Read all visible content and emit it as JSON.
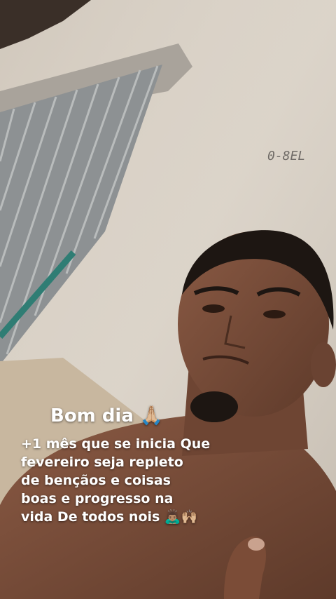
{
  "story": {
    "title": "Bom dia 🙏🏼",
    "caption_lines": [
      "+1 mês que se inicia Que",
      "fevereiro seja repleto",
      "de bençãos e coisas",
      "boas e progresso na",
      "vida De todos nois 🙇🏽‍♂️🙌🏼"
    ],
    "wall_text": "0-8EL"
  },
  "colors": {
    "wall": "#d9d2c8",
    "shutter": "#8c8f90",
    "skin": "#7a4c38",
    "hair": "#1d1612",
    "text": "#ffffff"
  }
}
